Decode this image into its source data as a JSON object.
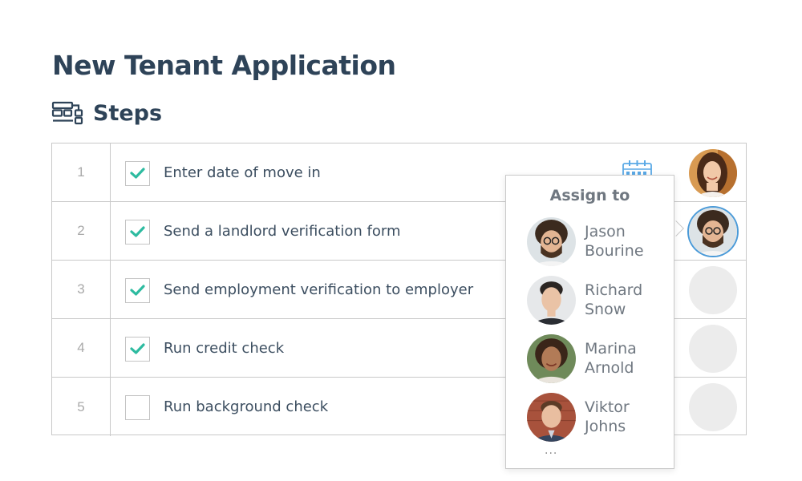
{
  "page": {
    "title": "New Tenant Application"
  },
  "steps_section": {
    "title": "Steps",
    "icon": "workflow-steps-icon"
  },
  "steps": [
    {
      "number": "1",
      "label": "Enter date of move in",
      "checked": true,
      "assignee": "woman-long-hair"
    },
    {
      "number": "2",
      "label": "Send a landlord verification form",
      "checked": true,
      "assignee": "Jason Bourine"
    },
    {
      "number": "3",
      "label": "Send employment verification to employer",
      "checked": true,
      "assignee": null
    },
    {
      "number": "4",
      "label": "Run credit check",
      "checked": true,
      "assignee": null
    },
    {
      "number": "5",
      "label": "Run background check",
      "checked": false,
      "assignee": null
    }
  ],
  "assign_popover": {
    "title": "Assign to",
    "people": [
      {
        "first": "Jason",
        "last": "Bourine"
      },
      {
        "first": "Richard",
        "last": "Snow"
      },
      {
        "first": "Marina",
        "last": "Arnold"
      },
      {
        "first": "Viktor",
        "last": "Johns"
      }
    ],
    "more": "..."
  },
  "colors": {
    "title": "#2e4358",
    "check": "#2dbba0",
    "border": "#c9c9c9",
    "selected_ring": "#4a9ad8",
    "calendar": "#5aa9e6"
  }
}
